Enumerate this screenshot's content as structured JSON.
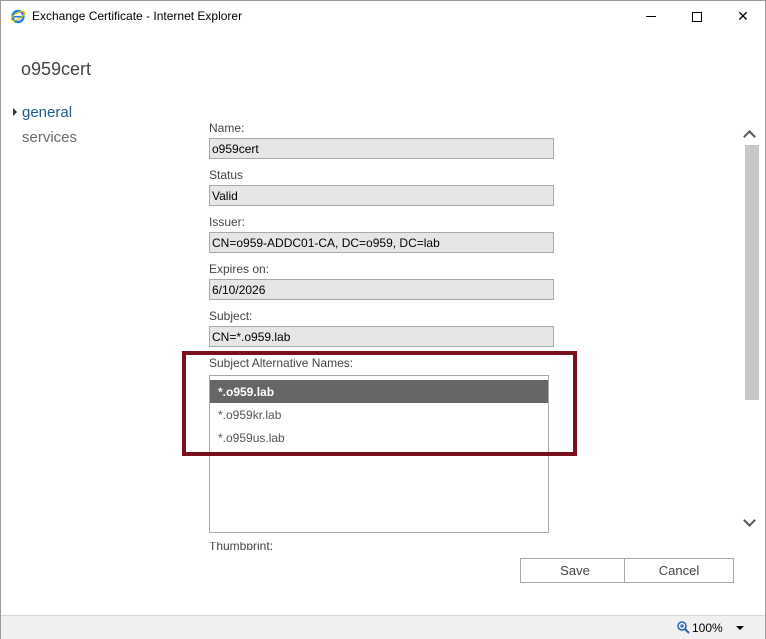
{
  "window": {
    "title": "Exchange Certificate - Internet Explorer",
    "minimize_icon": "minimize-icon",
    "maximize_icon": "maximize-icon",
    "close_glyph": "✕"
  },
  "page": {
    "title": "o959cert"
  },
  "nav": {
    "items": [
      {
        "label": "general",
        "active": true
      },
      {
        "label": "services",
        "active": false
      }
    ]
  },
  "fields": {
    "name": {
      "label": "Name:",
      "value": "o959cert"
    },
    "status": {
      "label": "Status",
      "value": "Valid"
    },
    "issuer": {
      "label": "Issuer:",
      "value": "CN=o959-ADDC01-CA, DC=o959, DC=lab"
    },
    "expires": {
      "label": "Expires on:",
      "value": "6/10/2026"
    },
    "subject": {
      "label": "Subject:",
      "value": "CN=*.o959.lab"
    },
    "san": {
      "label": "Subject Alternative Names:",
      "items": [
        "*.o959.lab",
        "*.o959kr.lab",
        "*.o959us.lab"
      ],
      "selected_index": 0
    },
    "thumbprint": {
      "label": "Thumbprint:"
    }
  },
  "buttons": {
    "save": "Save",
    "cancel": "Cancel"
  },
  "statusbar": {
    "zoom": "100%"
  },
  "colors": {
    "highlight": "#7a0f1e",
    "selected_row": "#666666",
    "nav_active": "#1e5a96"
  }
}
